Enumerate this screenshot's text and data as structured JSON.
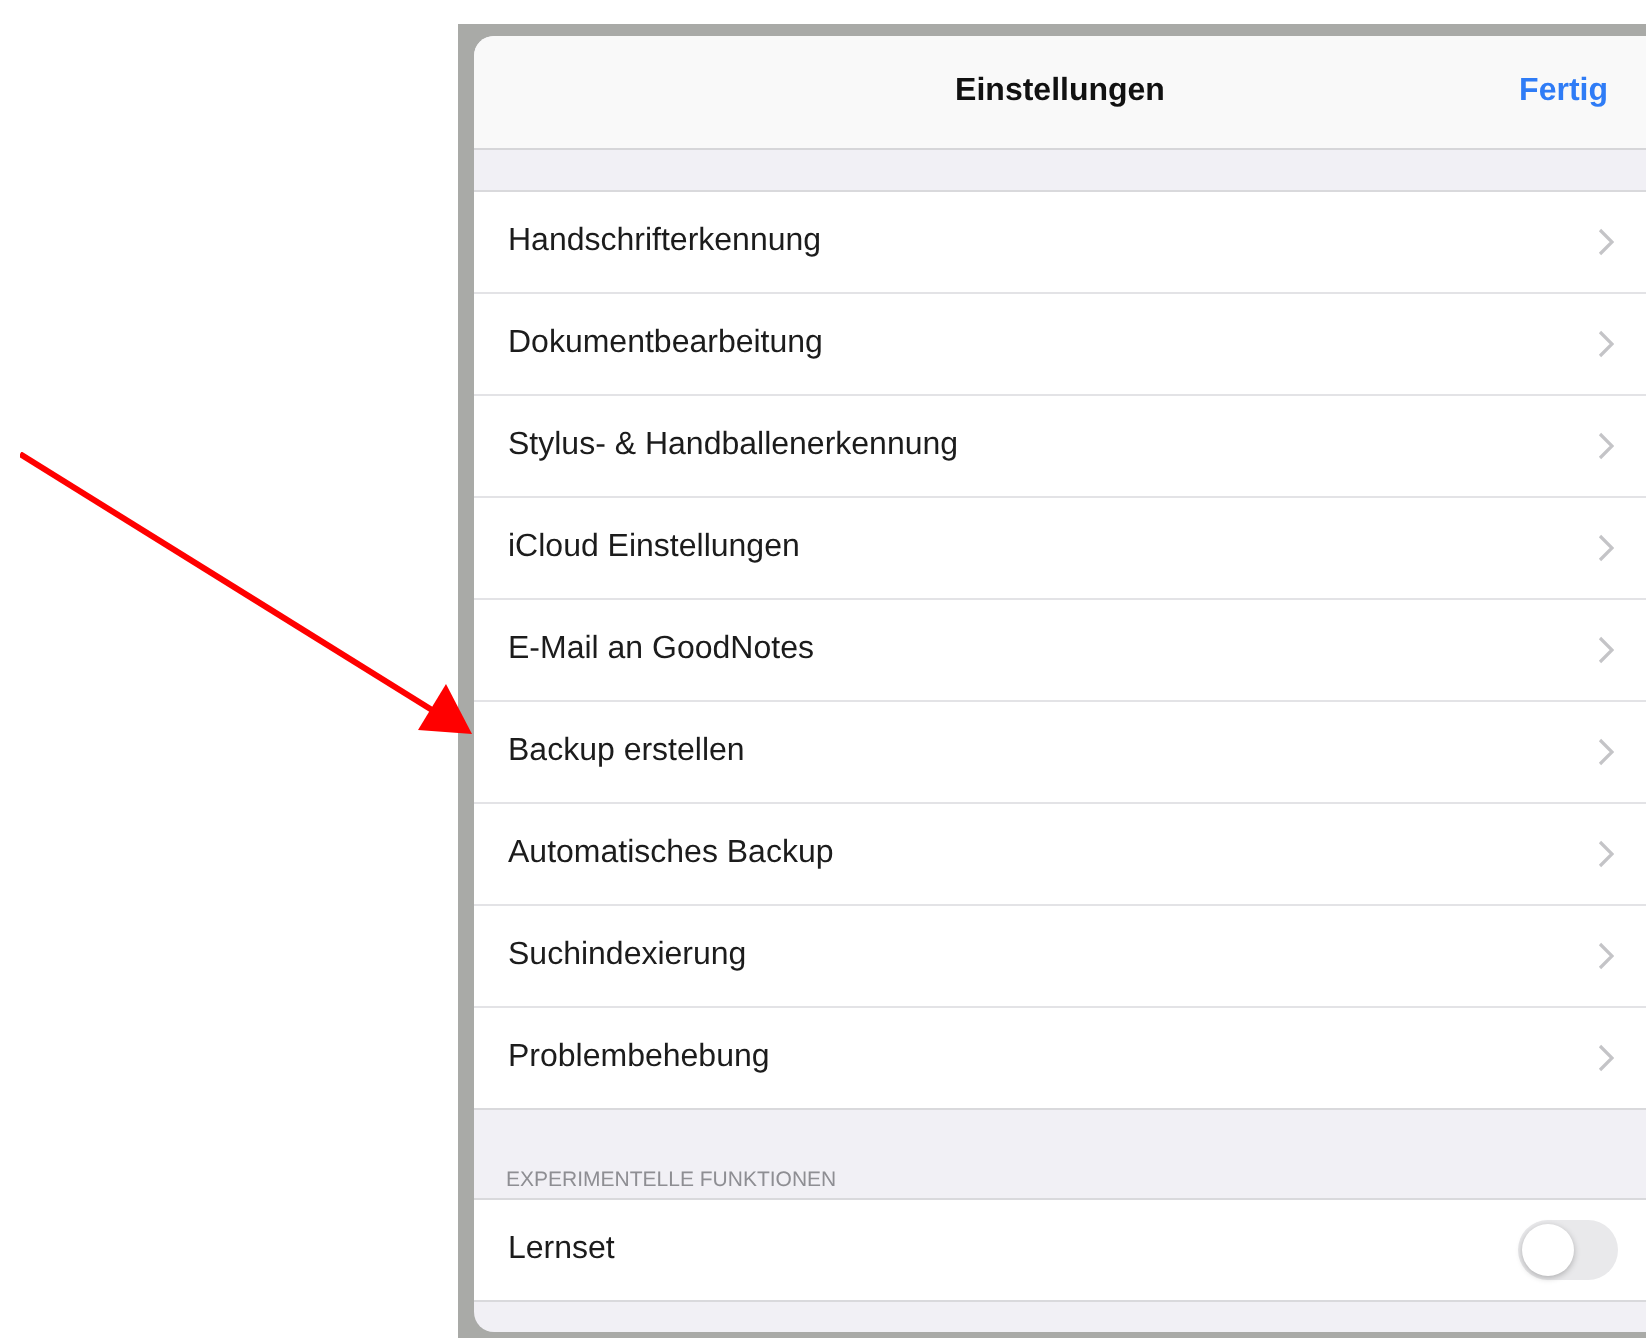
{
  "header": {
    "title": "Einstellungen",
    "done_button": "Fertig"
  },
  "items": [
    {
      "label": "Handschrifterkennung"
    },
    {
      "label": "Dokumentbearbeitung"
    },
    {
      "label": "Stylus- & Handballenerkennung"
    },
    {
      "label": "iCloud Einstellungen"
    },
    {
      "label": "E-Mail an GoodNotes"
    },
    {
      "label": "Backup erstellen"
    },
    {
      "label": "Automatisches Backup"
    },
    {
      "label": "Suchindexierung"
    },
    {
      "label": "Problembehebung"
    }
  ],
  "section": {
    "title": "EXPERIMENTELLE FUNKTIONEN",
    "items": [
      {
        "label": "Lernset",
        "on": false
      }
    ]
  }
}
